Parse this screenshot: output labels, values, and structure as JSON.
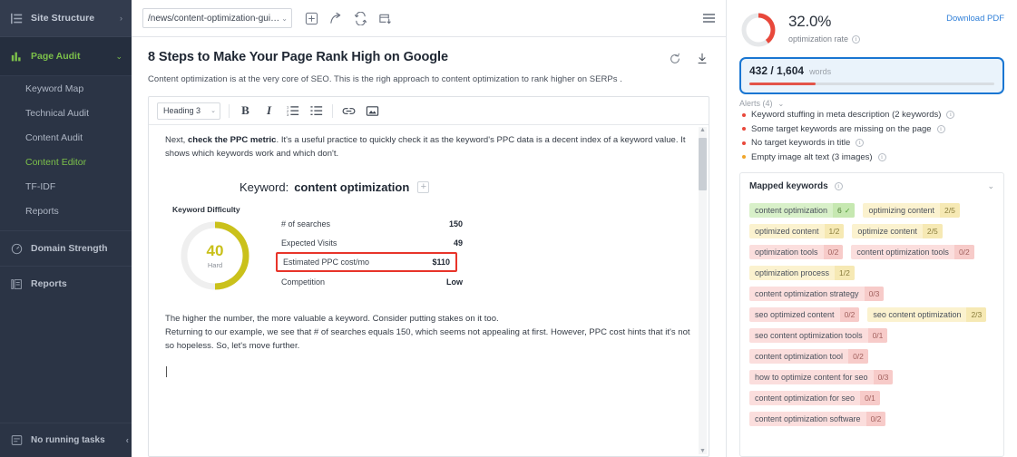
{
  "sidebar": {
    "site_structure": {
      "label": "Site Structure",
      "icon": "list-icon",
      "chevron": "›"
    },
    "page_audit": {
      "label": "Page Audit",
      "icon": "bar-chart-icon",
      "chevron": "⌄"
    },
    "items": [
      {
        "label": "Keyword Map",
        "active": false
      },
      {
        "label": "Technical Audit",
        "active": false
      },
      {
        "label": "Content Audit",
        "active": false
      },
      {
        "label": "Content Editor",
        "active": true
      },
      {
        "label": "TF-IDF",
        "active": false
      },
      {
        "label": "Reports",
        "active": false
      }
    ],
    "domain_strength": {
      "label": "Domain Strength",
      "icon": "gauge-icon"
    },
    "reports": {
      "label": "Reports",
      "icon": "report-icon"
    },
    "footer": {
      "label": "No running tasks",
      "icon": "task-icon",
      "collapse": "‹"
    }
  },
  "topbar": {
    "url": "/news/content-optimization-guide.html",
    "chevron": "⌄",
    "icons": [
      "add-page-icon",
      "share-icon",
      "refresh-icon",
      "export-icon"
    ],
    "menu": "hamburger-menu-icon"
  },
  "document": {
    "title": "8 Steps to Make Your Page Rank High on Google",
    "description": "Content optimization is at the very core of SEO. This is the righ approach to content optimization to rank higher on SERPs .",
    "icons": [
      "refresh-icon",
      "download-icon"
    ]
  },
  "editor": {
    "toolbar": {
      "heading": "Heading 3",
      "chevron": "⌄",
      "bold": "B",
      "italic": "I",
      "ordered_list": "ordered-list-icon",
      "bullet_list": "bullet-list-icon",
      "link": "link-icon",
      "image": "image-icon"
    },
    "paragraph1_pre": "Next, ",
    "paragraph1_bold": "check the PPC metric",
    "paragraph1_post": ". It's a useful practice to quickly check it as the keyword's PPC data is a decent index of a keyword value. It shows which keywords work and which don't.",
    "paragraph2_line1": "The higher the number, the more valuable a keyword. Consider putting stakes on it too.",
    "paragraph2_line2": "Returning to our example, we see that # of searches equals 150, which seems not appealing at first. However, PPC cost hints that it's not so hopeless. So, let's move further."
  },
  "keyword_card": {
    "lead": "Keyword:",
    "keyword": "content optimization",
    "add_icon": "+",
    "difficulty_label": "Keyword Difficulty",
    "difficulty_value": "40",
    "difficulty_sub": "Hard",
    "difficulty_color": "#c9c01a",
    "rows": [
      {
        "key": "# of searches",
        "value": "150",
        "highlight": false
      },
      {
        "key": "Expected Visits",
        "value": "49",
        "highlight": false
      },
      {
        "key": "Estimated PPC cost/mo",
        "value": "$110",
        "highlight": true
      },
      {
        "key": "Competition",
        "value": "Low",
        "highlight": false
      }
    ],
    "highlight_color": "#e8342a"
  },
  "right_panel": {
    "optimization": {
      "percent": "32.0%",
      "label": "optimization rate",
      "value": 32.0,
      "color": "#e8483b",
      "track": "#e6e8ea",
      "download_pdf": "Download PDF"
    },
    "words": {
      "count": "432 / 1,604",
      "label": "words",
      "progress": 27,
      "bar_color": "#e35449",
      "border_color": "#1976d2"
    },
    "alerts": {
      "header": "Alerts (4)",
      "chevron": "⌄",
      "items": [
        {
          "text": "Keyword stuffing in meta description (2 keywords)",
          "color": "#e8483b"
        },
        {
          "text": "Some target keywords are missing on the page",
          "color": "#e8483b"
        },
        {
          "text": "No target keywords in title",
          "color": "#e8483b"
        },
        {
          "text": "Empty image alt text (3 images)",
          "color": "#f0a52a"
        }
      ]
    },
    "mapped_keywords": {
      "title": "Mapped keywords",
      "chevron": "⌄",
      "tags": [
        {
          "text": "content optimization",
          "count": "6",
          "tone": "green",
          "check": true
        },
        {
          "text": "optimizing content",
          "count": "2/5",
          "tone": "yellow",
          "check": false
        },
        {
          "text": "optimized content",
          "count": "1/2",
          "tone": "yellow",
          "check": false
        },
        {
          "text": "optimize content",
          "count": "2/5",
          "tone": "yellow",
          "check": false
        },
        {
          "text": "optimization tools",
          "count": "0/2",
          "tone": "pink",
          "check": false
        },
        {
          "text": "content optimization tools",
          "count": "0/2",
          "tone": "pink",
          "check": false
        },
        {
          "text": "optimization process",
          "count": "1/2",
          "tone": "yellow",
          "check": false
        },
        {
          "text": "content optimization strategy",
          "count": "0/3",
          "tone": "pink",
          "check": false
        },
        {
          "text": "seo optimized content",
          "count": "0/2",
          "tone": "pink",
          "check": false
        },
        {
          "text": "seo content optimization",
          "count": "2/3",
          "tone": "yellow",
          "check": false
        },
        {
          "text": "seo content optimization tools",
          "count": "0/1",
          "tone": "pink",
          "check": false
        },
        {
          "text": "content optimization tool",
          "count": "0/2",
          "tone": "pink",
          "check": false
        },
        {
          "text": "how to optimize content for seo",
          "count": "0/3",
          "tone": "pink",
          "check": false
        },
        {
          "text": "content optimization for seo",
          "count": "0/1",
          "tone": "pink",
          "check": false
        },
        {
          "text": "content optimization software",
          "count": "0/2",
          "tone": "pink",
          "check": false
        }
      ]
    }
  }
}
